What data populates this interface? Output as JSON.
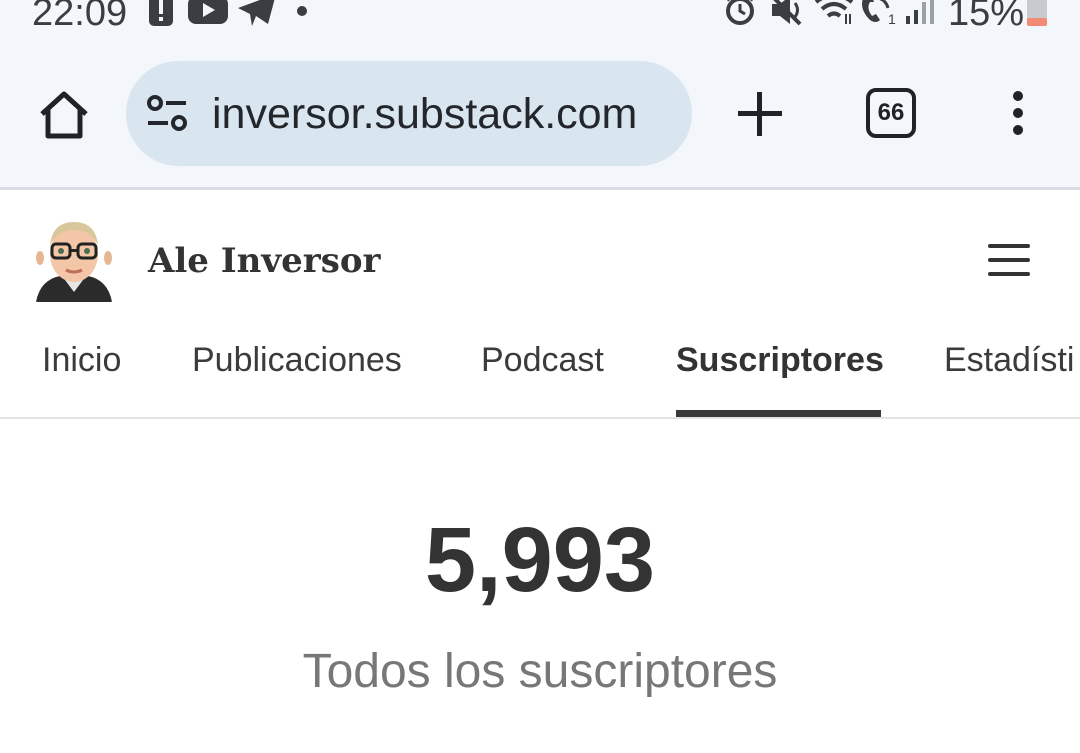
{
  "status_bar": {
    "time": "22:09",
    "battery_text": "15%",
    "icons": [
      "alert-icon",
      "youtube-icon",
      "telegram-icon",
      "dot-icon",
      "alarm-icon",
      "mute-icon",
      "wifi-icon",
      "wifi-call-icon",
      "signal-icon",
      "battery-icon"
    ],
    "battery_color": "#f28b74"
  },
  "browser": {
    "url": "inversor.substack.com",
    "tab_count": "66",
    "pill_color": "#dae6ef",
    "bar_color": "#f3f6fb"
  },
  "site": {
    "title": "Ale Inversor"
  },
  "nav": {
    "tabs": [
      {
        "label": "Inicio"
      },
      {
        "label": "Publicaciones"
      },
      {
        "label": "Podcast"
      },
      {
        "label": "Suscriptores",
        "active": true
      },
      {
        "label": "Estadísti"
      }
    ]
  },
  "stats": {
    "value": "5,993",
    "label": "Todos los suscriptores"
  }
}
